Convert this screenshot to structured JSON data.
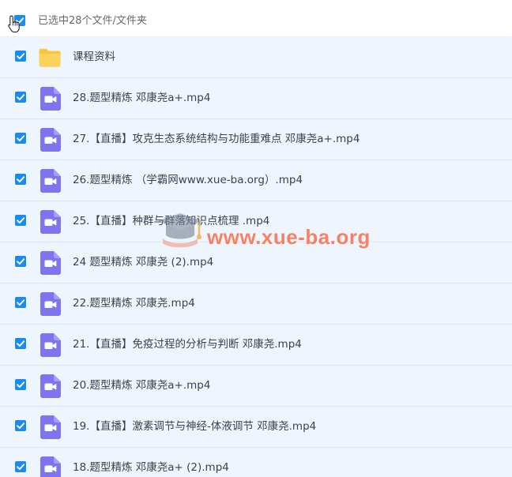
{
  "header": {
    "selection_text": "已选中28个文件/文件夹"
  },
  "files": [
    {
      "type": "folder",
      "name": "课程资料"
    },
    {
      "type": "video",
      "name": "28.题型精炼 邓康尧a+.mp4"
    },
    {
      "type": "video",
      "name": "27.【直播】攻克生态系统结构与功能重难点 邓康尧a+.mp4"
    },
    {
      "type": "video",
      "name": "26.题型精炼 （学霸网www.xue-ba.org）.mp4"
    },
    {
      "type": "video",
      "name": "25.【直播】种群与群落知识点梳理 .mp4"
    },
    {
      "type": "video",
      "name": "24 题型精炼 邓康尧 (2).mp4"
    },
    {
      "type": "video",
      "name": "22.题型精炼 邓康尧.mp4"
    },
    {
      "type": "video",
      "name": "21.【直播】免疫过程的分析与判断 邓康尧.mp4"
    },
    {
      "type": "video",
      "name": "20.题型精炼 邓康尧a+.mp4"
    },
    {
      "type": "video",
      "name": "19.【直播】激素调节与神经-体液调节 邓康尧.mp4"
    },
    {
      "type": "video",
      "name": "18.题型精炼 邓康尧a+ (2).mp4"
    }
  ],
  "watermark": {
    "text": "www.xue-ba.org"
  },
  "colors": {
    "checkbox": "#1a8bf0",
    "row_background": "#eef5fd",
    "video_icon": "#7f74ee",
    "folder_icon": "#f9c53b",
    "watermark": "#f85228"
  },
  "icons": {
    "checkbox": "checkmark-icon",
    "folder": "folder-icon",
    "video": "video-file-icon",
    "cursor": "hand-pointer-icon"
  }
}
